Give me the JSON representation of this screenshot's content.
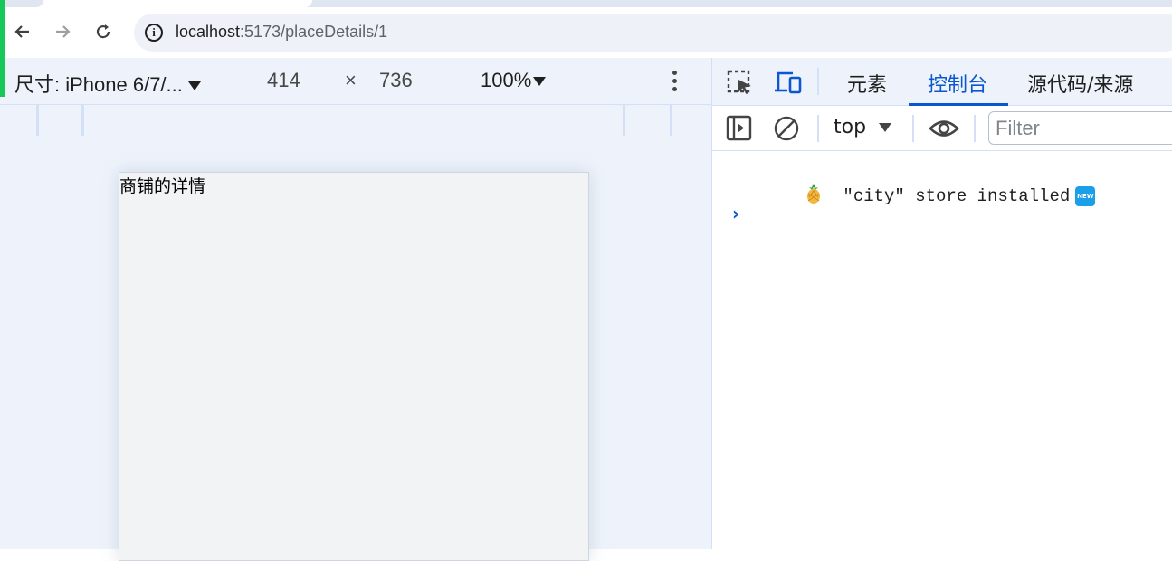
{
  "browser": {
    "url_host": "localhost",
    "url_rest": ":5173/placeDetails/1",
    "icons": [
      "back-icon",
      "forward-icon",
      "reload-icon",
      "info-icon"
    ]
  },
  "device_toolbar": {
    "device_label": "尺寸: iPhone 6/7/...",
    "width": "414",
    "times": "×",
    "height": "736",
    "zoom": "100%"
  },
  "page": {
    "content_text": "商铺的详情"
  },
  "devtools": {
    "tabs": [
      "元素",
      "控制台",
      "源代码/来源"
    ],
    "active_tab": "控制台",
    "context": "top",
    "filter_placeholder": "Filter",
    "console_message": "\"city\" store installed",
    "badge": "NEW",
    "prompt": "›",
    "accent_color": "#0b57d0"
  }
}
